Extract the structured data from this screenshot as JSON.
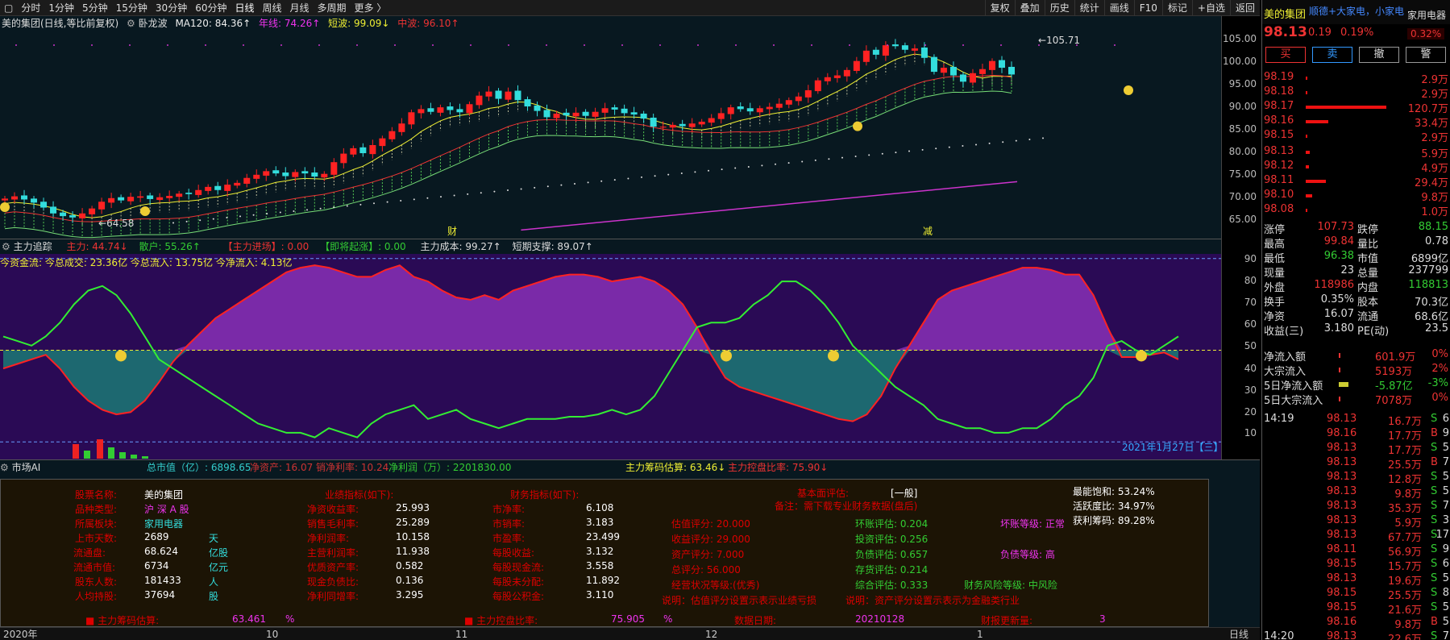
{
  "toolbar": {
    "tabs": [
      "分时",
      "1分钟",
      "5分钟",
      "15分钟",
      "30分钟",
      "60分钟",
      "日线",
      "周线",
      "月线",
      "多周期",
      "更多"
    ],
    "right": [
      "复权",
      "叠加",
      "历史",
      "统计",
      "画线",
      "F10",
      "标记",
      "+自选",
      "返回"
    ]
  },
  "kline": {
    "info": {
      "name": "美的集团(日线,等比前复权)",
      "indicator": "卧龙波",
      "ma120": "MA120: 84.36↑",
      "annual": "年线: 74.26↑",
      "short": "短波: 99.09↓",
      "mid": "中波: 96.10↑"
    },
    "high_label": "105.71",
    "low_label": "64.58",
    "markers": [
      "财",
      "减"
    ],
    "axis": [
      "105.00",
      "100.00",
      "95.00",
      "90.00",
      "85.00",
      "80.00",
      "75.00",
      "70.00",
      "65.00"
    ]
  },
  "chart_data": [
    {
      "type": "candlestick",
      "title": "美的集团(日线,等比前复权)",
      "ylim": [
        62.5,
        107.5
      ],
      "close": [
        70.5,
        71,
        70.3,
        69.6,
        68.5,
        67.2,
        66.6,
        66.3,
        67.2,
        68.3,
        69.8,
        70.6,
        70.1,
        70.9,
        71,
        70.4,
        70.8,
        71.1,
        71.6,
        71.5,
        72.4,
        73.1,
        72.4,
        73.6,
        74,
        75.1,
        75.8,
        76.6,
        76.1,
        75.5,
        76.4,
        76.1,
        75.4,
        76,
        78.6,
        80.5,
        81.7,
        80.6,
        82.4,
        83.9,
        85.5,
        87.2,
        89.7,
        90.4,
        89.8,
        90.8,
        90.2,
        89.7,
        91.5,
        93.4,
        94.3,
        92.7,
        94.3,
        92.4,
        91,
        90,
        88.6,
        89.4,
        89,
        89.6,
        88.9,
        89.8,
        90.6,
        90.3,
        89.5,
        89.2,
        88.3,
        86.5,
        86.5,
        86.9,
        86.6,
        87.2,
        87.6,
        88.4,
        89.5,
        90.8,
        90.4,
        89.9,
        90.6,
        90.9,
        91.6,
        92.4,
        93.2,
        94.6,
        96.8,
        97.5,
        97.9,
        99.1,
        101.1,
        103.4,
        102.5,
        104.6,
        104.4,
        103.6,
        103.9,
        101.8,
        98.7,
        99.6,
        97.9,
        96.5,
        98.4,
        99.3,
        101.1,
        99.6,
        98.1
      ],
      "moving_averages": {
        "ma120": 84.36,
        "annual": 74.26,
        "short_wave": 99.09,
        "mid_wave": 96.1
      },
      "annotations": {
        "high": 105.71,
        "low": 64.58
      }
    },
    {
      "type": "area",
      "title": "主力追踪",
      "ylim": [
        2,
        92
      ],
      "main_force": [
        42,
        44,
        46,
        48,
        42,
        34,
        28,
        24,
        22,
        23,
        28,
        36,
        45,
        52,
        58,
        64,
        68,
        72,
        76,
        80,
        84,
        86,
        87,
        86,
        84,
        82,
        82,
        85,
        87,
        82,
        80,
        76,
        73,
        72,
        74,
        72,
        76,
        78,
        80,
        82,
        83,
        83,
        82,
        80,
        81,
        82,
        80,
        76,
        70,
        60,
        48,
        38,
        34,
        32,
        30,
        28,
        26,
        24,
        22,
        20,
        19,
        22,
        30,
        42,
        52,
        62,
        72,
        76,
        78,
        80,
        82,
        84,
        86,
        86,
        85,
        83,
        83,
        74,
        60,
        47,
        47,
        48,
        49,
        46
      ],
      "retail": [
        56,
        54,
        52,
        56,
        62,
        70,
        76,
        78,
        74,
        66,
        56,
        46,
        42,
        38,
        34,
        30,
        26,
        22,
        18,
        16,
        14,
        14,
        12,
        16,
        14,
        12,
        18,
        22,
        24,
        26,
        20,
        22,
        24,
        20,
        18,
        16,
        18,
        20,
        20,
        20,
        21,
        21,
        22,
        24,
        22,
        24,
        30,
        40,
        50,
        60,
        62,
        62,
        64,
        70,
        74,
        80,
        80,
        76,
        70,
        62,
        52,
        46,
        40,
        34,
        30,
        26,
        20,
        18,
        16,
        16,
        14,
        14,
        16,
        16,
        20,
        26,
        30,
        38,
        52,
        54,
        50,
        48,
        52,
        56
      ],
      "axis": [
        10,
        20,
        30,
        40,
        50,
        60,
        70,
        80,
        90
      ],
      "date_label": "2021年1月27日【三】"
    }
  ],
  "tracker": {
    "title": "主力追踪",
    "main": "主力: 44.74↓",
    "retail": "散户: 55.26↑",
    "entry": "【主力进场】: 0.00",
    "surge": "【即将起涨】: 0.00",
    "cost": "主力成本: 99.27↑",
    "support": "短期支撑: 89.07↑",
    "flow": "今资金流: 今总成交: 23.36亿 今总流入: 13.75亿 今净流入: 4.13亿"
  },
  "ai": {
    "title": "市场AI",
    "mktcap": "总市值（亿）: 6898.65",
    "netasset": "净资产: 16.07",
    "netmargin": "销净利率: 10.24",
    "netprofit": "净利润（万）: 2201830.00",
    "chip": "主力筹码估算: 63.46↓",
    "control": "主力控盘比率: 75.90↓"
  },
  "panel": {
    "col1_labels": [
      "股票名称:",
      "品种类型:",
      "所属板块:",
      "上市天数:",
      "流通盘:",
      "流通市值:",
      "股东人数:",
      "人均持股:"
    ],
    "col1_values": [
      "美的集团",
      "沪 深 A 股",
      "家用电器",
      "2689",
      "68.624",
      "6734",
      "181433",
      "37694"
    ],
    "col1_units": [
      "",
      "",
      "",
      "天",
      "亿股",
      "亿元",
      "人",
      "股"
    ],
    "col2_title": "业绩指标(如下):",
    "col2_labels": [
      "净资收益率:",
      "销售毛利率:",
      "净利润率:",
      "主营利润率:",
      "优质资产率:",
      "现金负债比:",
      "净利同增率:"
    ],
    "col2_values": [
      "25.993",
      "25.289",
      "10.158",
      "11.938",
      "0.582",
      "0.136",
      "3.295"
    ],
    "col3_title": "财务指标(如下):",
    "col3_labels": [
      "市净率:",
      "市销率:",
      "市盈率:",
      "每股收益:",
      "每股现金流:",
      "每股未分配:",
      "每股公积金:"
    ],
    "col3_values": [
      "6.108",
      "3.183",
      "23.499",
      "3.132",
      "3.558",
      "11.892",
      "3.110"
    ],
    "eval_title": "基本面评估:",
    "eval_value": "[一般]",
    "note": "备注：需下载专业财务数据(盘后)",
    "scores_a": [
      "估值评分: 20.000",
      "收益评分: 29.000",
      "资产评分: 7.000",
      "总评分: 56.000",
      "经营状况等级:(优秀)"
    ],
    "scores_b": [
      "环账评估: 0.204",
      "投资评估: 0.256",
      "负债评估: 0.657",
      "存货评估: 0.214",
      "综合评估: 0.333"
    ],
    "rating_b": [
      "坏账等级: 正常",
      "负债等级: 高",
      "财务风险等级: 中风险"
    ],
    "explain1": "说明：估值评分设置示表示业绩亏损",
    "explain2": "说明：资产评分设置示表示为金融类行业",
    "right_stats": [
      "最能饱和: 53.24%",
      "活跃度比: 34.97%",
      "获利筹码: 89.28%"
    ],
    "bottom": [
      "■ 主力筹码估算:",
      "63.461",
      "%",
      "■ 主力控盘比率:",
      "75.905",
      "%",
      "数据日期:",
      "20210128",
      "财报更新量:",
      "3"
    ]
  },
  "timeaxis": [
    "2020年",
    "10",
    "11",
    "12",
    "1",
    "日线"
  ],
  "side": {
    "name": "美的集团",
    "concept": "顺德+大家电，小家电",
    "sector": "家用电器",
    "price": "98.13",
    "change": "0.19",
    "pct": "0.19%",
    "sector_pct": "0.32%",
    "buttons": [
      "买",
      "卖",
      "撤",
      "警"
    ],
    "asks": [
      {
        "p": "98.19",
        "v": "2.9万",
        "w": 2
      },
      {
        "p": "98.18",
        "v": "2.9万",
        "w": 2
      },
      {
        "p": "98.17",
        "v": "120.7万",
        "w": 95
      },
      {
        "p": "98.16",
        "v": "33.4万",
        "w": 27
      },
      {
        "p": "98.15",
        "v": "2.9万",
        "w": 2
      }
    ],
    "bids": [
      {
        "p": "98.13",
        "v": "5.9万",
        "w": 5
      },
      {
        "p": "98.12",
        "v": "4.9万",
        "w": 4
      },
      {
        "p": "98.11",
        "v": "29.4万",
        "w": 24
      },
      {
        "p": "98.10",
        "v": "9.8万",
        "w": 8
      },
      {
        "p": "98.08",
        "v": "1.0万",
        "w": 1
      }
    ],
    "stats": [
      [
        "涨停",
        "107.73",
        "跌停",
        "88.15"
      ],
      [
        "最高",
        "99.84",
        "量比",
        "0.78"
      ],
      [
        "最低",
        "96.38",
        "市值",
        "6899亿"
      ],
      [
        "现量",
        "23",
        "总量",
        "237799"
      ],
      [
        "外盘",
        "118986",
        "内盘",
        "118813"
      ],
      [
        "换手",
        "0.35%",
        "股本",
        "70.3亿"
      ],
      [
        "净资",
        "16.07",
        "流通",
        "68.6亿"
      ],
      [
        "收益(三)",
        "3.180",
        "PE(动)",
        "23.5"
      ]
    ],
    "flows": [
      [
        "净流入额",
        "601.9万",
        "0%"
      ],
      [
        "大宗流入",
        "5193万",
        "2%"
      ],
      [
        "5日净流入额",
        "-5.87亿",
        "-3%"
      ],
      [
        "5日大宗流入",
        "7078万",
        "0%"
      ]
    ],
    "ticks": [
      [
        "14:19",
        "98.13",
        "16.7万",
        "S",
        "6"
      ],
      [
        "",
        "98.16",
        "17.7万",
        "B",
        "9"
      ],
      [
        "",
        "98.13",
        "17.7万",
        "S",
        "5"
      ],
      [
        "",
        "98.13",
        "25.5万",
        "B",
        "7"
      ],
      [
        "",
        "98.13",
        "12.8万",
        "S",
        "5"
      ],
      [
        "",
        "98.13",
        "9.8万",
        "S",
        "5"
      ],
      [
        "",
        "98.13",
        "35.3万",
        "S",
        "7"
      ],
      [
        "",
        "98.13",
        "5.9万",
        "S",
        "3"
      ],
      [
        "",
        "98.13",
        "67.7万",
        "S",
        "17"
      ],
      [
        "",
        "98.11",
        "56.9万",
        "S",
        "9"
      ],
      [
        "",
        "98.15",
        "15.7万",
        "S",
        "6"
      ],
      [
        "",
        "98.13",
        "19.6万",
        "S",
        "5"
      ],
      [
        "",
        "98.15",
        "25.5万",
        "S",
        "8"
      ],
      [
        "",
        "98.15",
        "21.6万",
        "S",
        "5"
      ],
      [
        "",
        "98.16",
        "9.8万",
        "B",
        "5"
      ],
      [
        "14:20",
        "98.13",
        "22.6万",
        "S",
        "7"
      ]
    ]
  }
}
